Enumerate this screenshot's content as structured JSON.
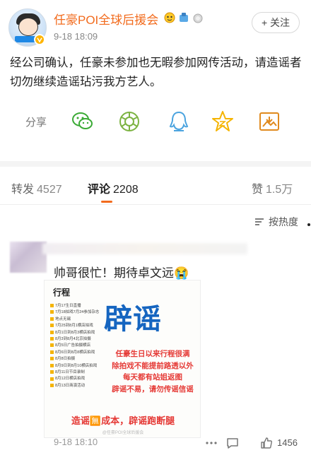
{
  "post": {
    "username": "任豪POI全球后援会",
    "timestamp": "9-18 18:09",
    "follow_label": "+ 关注",
    "text": "经公司确认，任豪未参加也无暇参加网传活动，请造谣者切勿继续造谣玷污我方艺人。",
    "share_label": "分享",
    "share_icons": [
      "wechat-icon",
      "moments-icon",
      "qq-icon",
      "favorite-icon",
      "save-image-icon"
    ]
  },
  "tabs": {
    "repost_label": "转发",
    "repost_count": "4527",
    "comment_label": "评论",
    "comment_count": "2208",
    "like_label": "赞",
    "like_count": "1.5万",
    "accent_color": "#f26b1d"
  },
  "sort": {
    "label": "按热度"
  },
  "comment": {
    "text": "帅哥很忙！期待卓文远😭",
    "poster": {
      "title": "行程",
      "big_text": "辟谣",
      "schedule": [
        "7月17生日直播",
        "7月18拍戏7月24参加杂志",
        "地点无锡",
        "7月25到8月1横店拍戏",
        "8月1日到8月3横店拍戏",
        "8月3到8月4北京拍摄",
        "8月5日广告拍摄横店",
        "8月6日到8月8横店拍戏",
        "8月8日拍摄",
        "8月9日到8月10横店拍戏",
        "8月11日节目录制",
        "8月12日横店拍戏",
        "8月13日商演活动"
      ],
      "message_lines": [
        "任豪生日以来行程很满",
        "除拍戏不能提前路透以外",
        "每天都有站姐返图",
        "辟谣不易，请勿传谣信谣"
      ],
      "bottom_line": "造谣🈚成本，辟谣跑断腿",
      "watermark": "@任豪POI全球后援会"
    },
    "time": "9-18 18:10",
    "like_count": "1456"
  }
}
